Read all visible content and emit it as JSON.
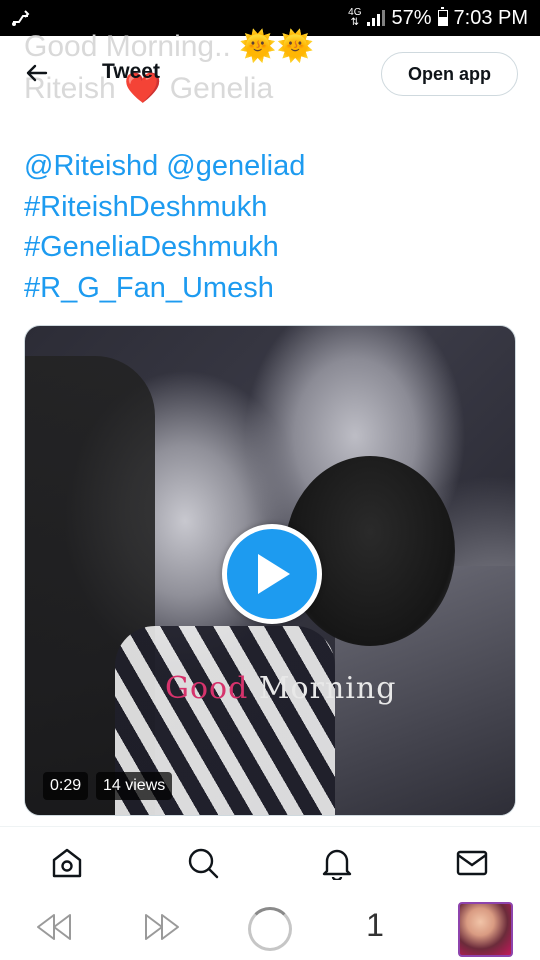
{
  "status_bar": {
    "network": "4G",
    "battery": "57%",
    "battery_level": 0.57,
    "time": "7:03 PM"
  },
  "ghost_header": {
    "line1": "Good Morning..",
    "line1_emoji": "🌞🌞",
    "line2_a": "Riteish",
    "line2_heart": "❤️",
    "line2_b": "Genelia"
  },
  "top_bar": {
    "back_icon": "arrow-left-icon",
    "title": "Tweet",
    "open_app_label": "Open app"
  },
  "tweet": {
    "tags": [
      "@Riteishd @geneliad",
      "#RiteishDeshmukh",
      "#GeneliaDeshmukh",
      "#R_G_Fan_Umesh"
    ]
  },
  "video": {
    "overlay_text_a": "Good",
    "overlay_text_b": "Morning",
    "duration": "0:29",
    "views": "14 views",
    "play_icon": "play-icon"
  },
  "bottom_nav": {
    "items": [
      "home-icon",
      "search-icon",
      "bell-icon",
      "mail-icon"
    ]
  },
  "browser_bar": {
    "tab_count": "1",
    "accent": "#8e44ad"
  },
  "colors": {
    "link": "#1d9bf0",
    "play_button": "#1d9bf0",
    "text": "#0f1419",
    "border": "#cfd9de"
  }
}
